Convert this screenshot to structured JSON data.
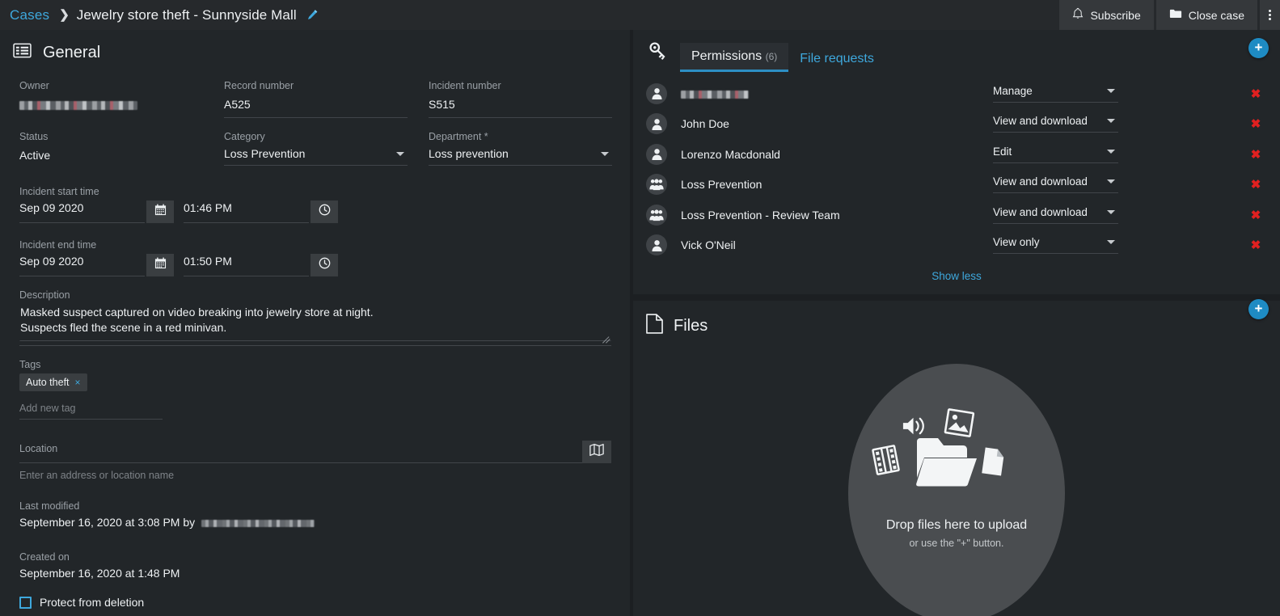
{
  "topbar": {
    "breadcrumb_root": "Cases",
    "breadcrumb_sep": "❯",
    "case_title": "Jewelry store theft - Sunnyside Mall",
    "edit_icon": "pencil-icon",
    "subscribe_label": "Subscribe",
    "subscribe_icon": "bell-icon",
    "close_case_label": "Close case",
    "close_case_icon": "folder-icon",
    "overflow_icon": "kebab-menu-icon"
  },
  "general": {
    "section_title": "General",
    "section_icon": "list-panel-icon",
    "owner_label": "Owner",
    "owner_value_redacted": "",
    "record_number_label": "Record number",
    "record_number_value": "A525",
    "incident_number_label": "Incident number",
    "incident_number_value": "S515",
    "status_label": "Status",
    "status_value": "Active",
    "category_label": "Category",
    "category_value": "Loss Prevention",
    "department_label": "Department *",
    "department_value": "Loss prevention",
    "incident_start_label": "Incident start time",
    "incident_start_date": "Sep 09 2020",
    "incident_start_time": "01:46 PM",
    "incident_end_label": "Incident end time",
    "incident_end_date": "Sep 09 2020",
    "incident_end_time": "01:50 PM",
    "calendar_icon": "calendar-icon",
    "clock_icon": "clock-icon",
    "description_label": "Description",
    "description_line1": "Masked suspect captured on video breaking into jewelry store at night.",
    "description_line2": "Suspects fled the scene in a red minivan.",
    "tags_label": "Tags",
    "tag_1": "Auto theft",
    "tag_remove": "×",
    "add_tag_placeholder": "Add new tag",
    "location_label": "Location",
    "location_value": "",
    "location_placeholder": "Enter an address or location name",
    "map_icon": "map-icon",
    "last_modified_label": "Last modified",
    "last_modified_value": "September 16, 2020 at 3:08 PM by",
    "created_on_label": "Created on",
    "created_on_value": "September 16, 2020 at 1:48 PM",
    "protect_label": "Protect from deletion",
    "protect_checked": false
  },
  "permissions": {
    "key_icon": "key-icon",
    "tab_permissions_label": "Permissions",
    "tab_permissions_count": "(6)",
    "tab_file_requests_label": "File requests",
    "add_button_icon": "plus-icon",
    "add_button_label": "+",
    "show_less_label": "Show less",
    "remove_icon": "remove-x-icon",
    "rows": [
      {
        "name": "",
        "redacted": true,
        "icon": "person-avatar-icon",
        "access": "Manage"
      },
      {
        "name": "John Doe",
        "redacted": false,
        "icon": "person-avatar-icon",
        "access": "View and download"
      },
      {
        "name": "Lorenzo Macdonald",
        "redacted": false,
        "icon": "person-avatar-icon",
        "access": "Edit"
      },
      {
        "name": "Loss Prevention",
        "redacted": false,
        "icon": "group-avatar-icon",
        "access": "View and download"
      },
      {
        "name": "Loss Prevention - Review Team",
        "redacted": false,
        "icon": "group-avatar-icon",
        "access": "View and download"
      },
      {
        "name": "Vick O'Neil",
        "redacted": false,
        "icon": "person-avatar-icon",
        "access": "View only"
      }
    ]
  },
  "files": {
    "section_title": "Files",
    "section_icon": "document-icon",
    "add_button_label": "+",
    "drop_main": "Drop files here to upload",
    "drop_sub": "or use the \"+\" button."
  },
  "colors": {
    "accent_blue": "#3ea8dd",
    "fab_blue": "#1e8bc3",
    "danger_red": "#e02020",
    "panel_bg": "#222629",
    "page_bg": "#1c1f22",
    "topbar_bg": "#26292c",
    "label_gray": "#9aa0a6",
    "text_white": "#eef1f3"
  }
}
